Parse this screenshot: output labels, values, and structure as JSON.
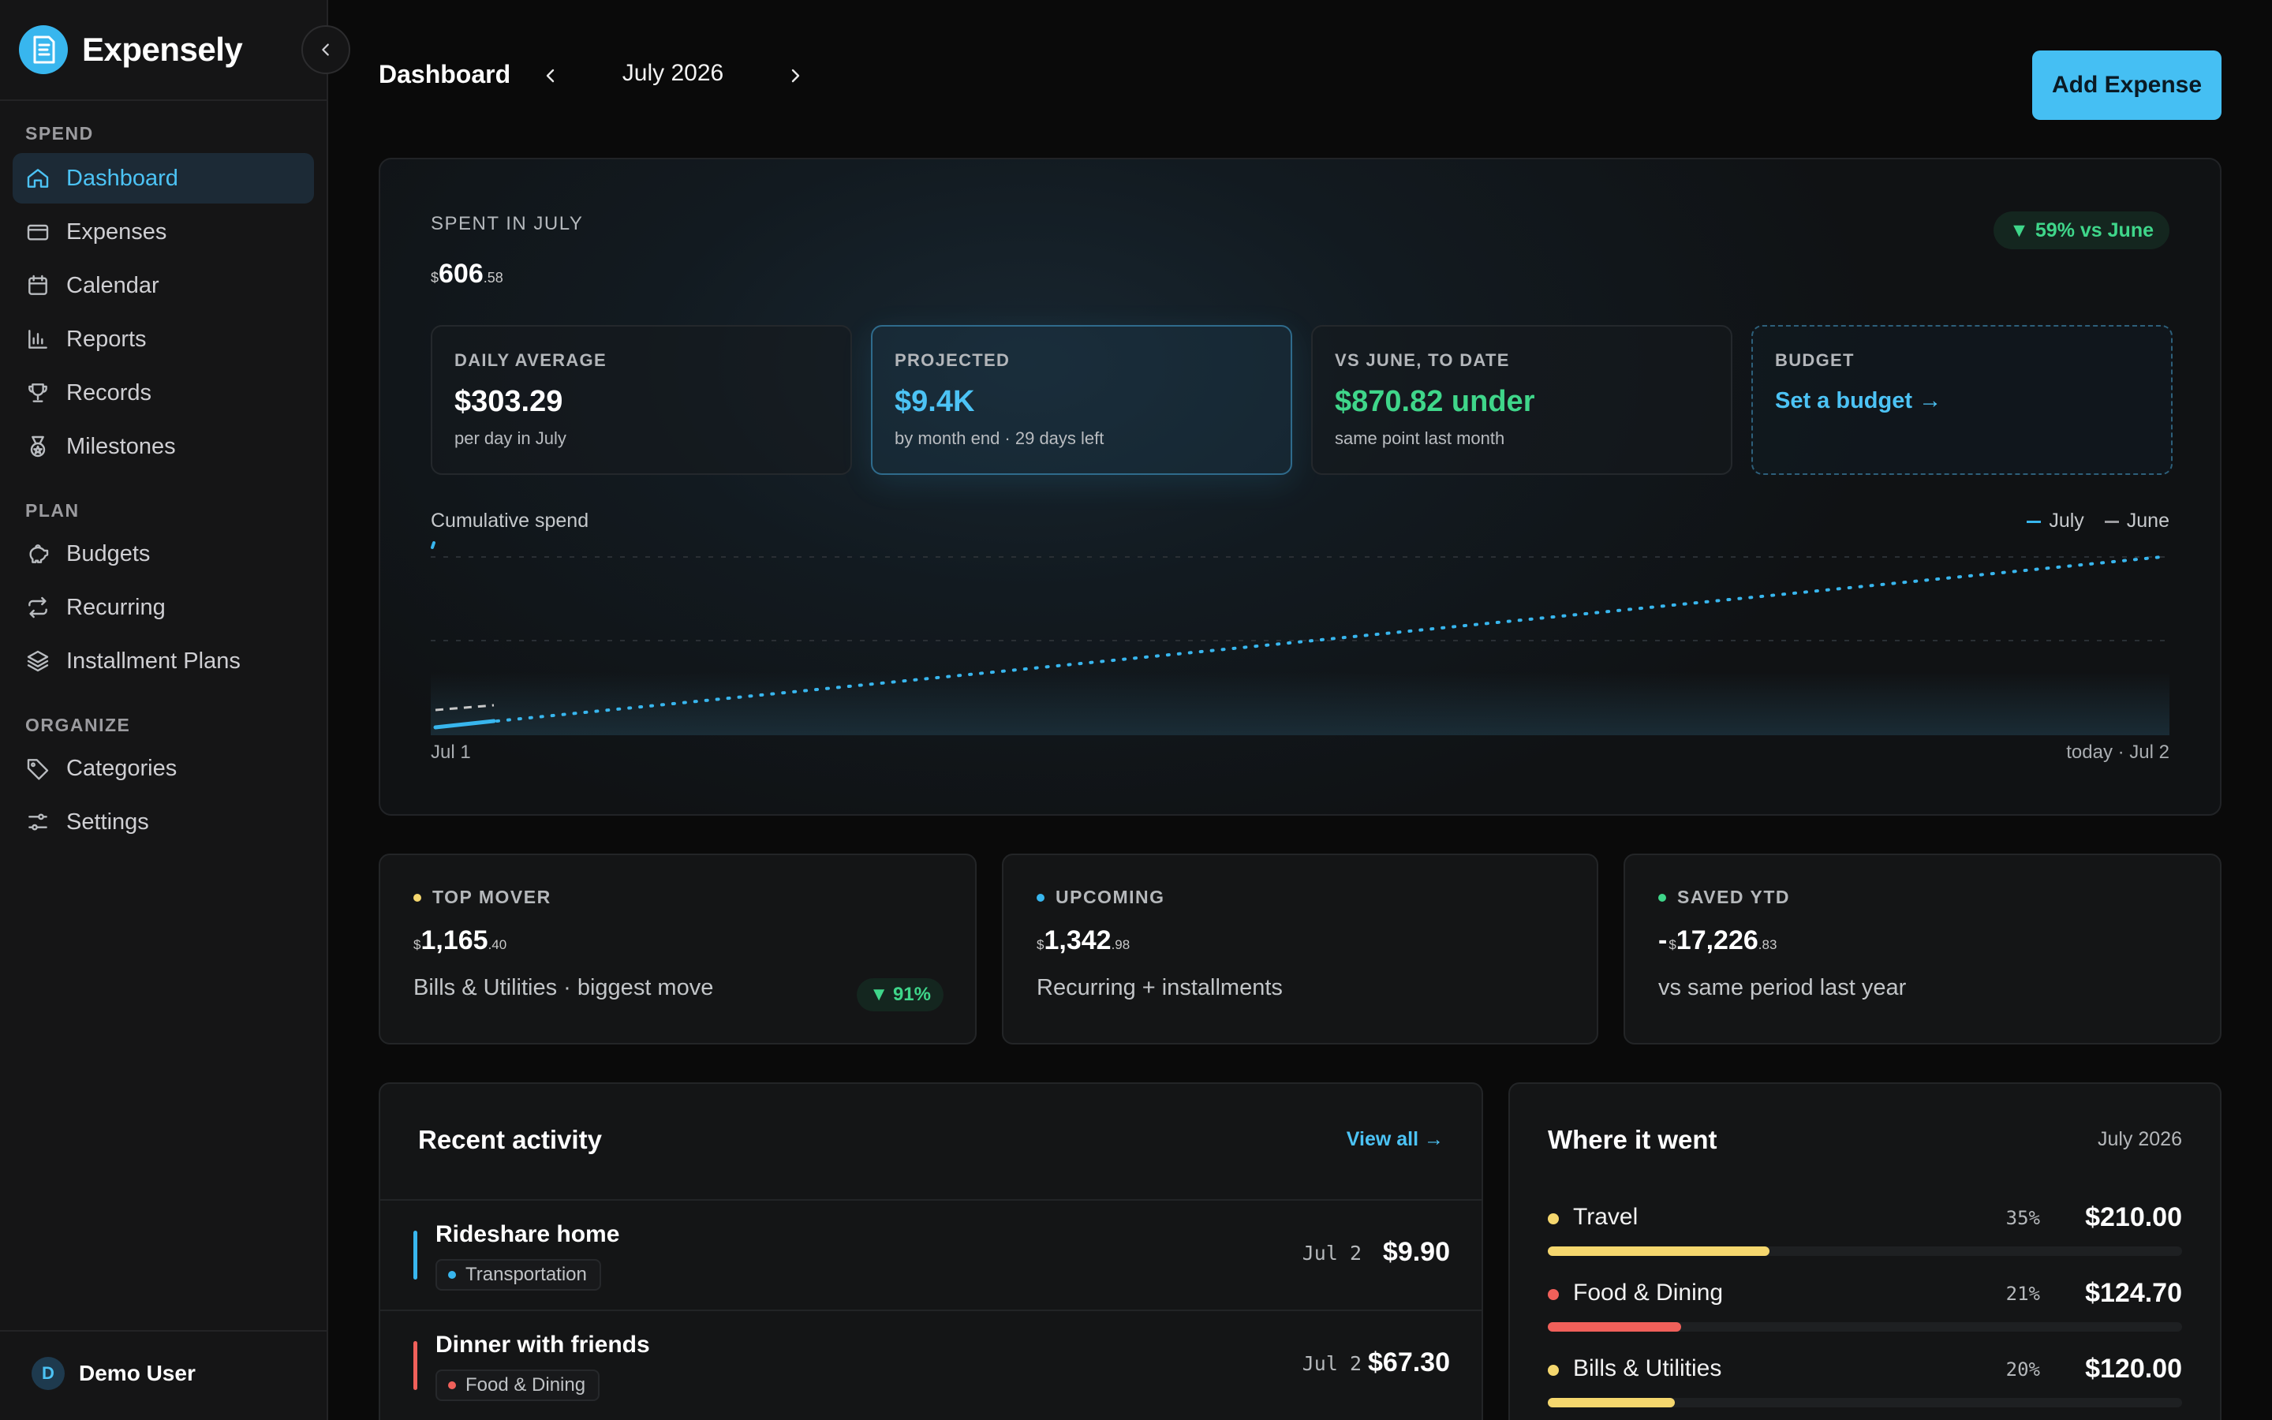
{
  "app": {
    "name": "Expensely"
  },
  "sidebar": {
    "sections": [
      {
        "label": "SPEND"
      },
      {
        "label": "PLAN"
      },
      {
        "label": "ORGANIZE"
      }
    ],
    "items": [
      {
        "label": "Dashboard",
        "icon": "home-icon",
        "active": true
      },
      {
        "label": "Expenses",
        "icon": "credit-card-icon"
      },
      {
        "label": "Calendar",
        "icon": "calendar-icon"
      },
      {
        "label": "Reports",
        "icon": "bar-chart-icon"
      },
      {
        "label": "Records",
        "icon": "trophy-icon"
      },
      {
        "label": "Milestones",
        "icon": "medal-icon"
      },
      {
        "label": "Budgets",
        "icon": "piggy-bank-icon"
      },
      {
        "label": "Recurring",
        "icon": "repeat-icon"
      },
      {
        "label": "Installment Plans",
        "icon": "layers-icon"
      },
      {
        "label": "Categories",
        "icon": "tag-icon"
      },
      {
        "label": "Settings",
        "icon": "sliders-icon"
      }
    ],
    "user": {
      "initial": "D",
      "name": "Demo User"
    }
  },
  "header": {
    "title": "Dashboard",
    "month": "July 2026",
    "add_button": "Add Expense"
  },
  "hero": {
    "label": "SPENT IN JULY",
    "amount": {
      "currency": "$",
      "int": "606",
      "dec": ".58"
    },
    "trend": {
      "arrow": "▼",
      "text": "59% vs June"
    },
    "stats": [
      {
        "label": "DAILY AVERAGE",
        "value": "$303.29",
        "sub": "per day in July"
      },
      {
        "label": "PROJECTED",
        "value": "$9.4K",
        "sub": "by month end · 29 days left"
      },
      {
        "label": "VS JUNE, TO DATE",
        "value": "$870.82 under",
        "sub": "same point last month"
      },
      {
        "label": "BUDGET",
        "link": "Set a budget →"
      }
    ],
    "chart": {
      "title": "Cumulative spend",
      "legend": [
        "July",
        "June"
      ],
      "axis_start": "Jul 1",
      "axis_end": "today · Jul 2"
    }
  },
  "kpis": [
    {
      "label": "TOP MOVER",
      "neg": "",
      "currency": "$",
      "int": "1,165",
      "dec": ".40",
      "sub": "Bills & Utilities · biggest move",
      "pill": {
        "arrow": "▼",
        "text": "91%"
      }
    },
    {
      "label": "UPCOMING",
      "neg": "",
      "currency": "$",
      "int": "1,342",
      "dec": ".98",
      "sub": "Recurring + installments"
    },
    {
      "label": "SAVED YTD",
      "neg": "-",
      "currency": "$",
      "int": "17,226",
      "dec": ".83",
      "sub": "vs same period last year"
    }
  ],
  "activity": {
    "title": "Recent activity",
    "view_all": "View all →",
    "items": [
      {
        "title": "Rideshare home",
        "category": "Transportation",
        "date": "Jul 2",
        "amount": "$9.90"
      },
      {
        "title": "Dinner with friends",
        "category": "Food & Dining",
        "date": "Jul 2",
        "amount": "$67.30"
      }
    ]
  },
  "where": {
    "title": "Where it went",
    "month": "July 2026",
    "items": [
      {
        "name": "Travel",
        "pct": "35%",
        "amount": "$210.00",
        "share": 0.35
      },
      {
        "name": "Food & Dining",
        "pct": "21%",
        "amount": "$124.70",
        "share": 0.21
      },
      {
        "name": "Bills & Utilities",
        "pct": "20%",
        "amount": "$120.00",
        "share": 0.2
      }
    ]
  },
  "colors": {
    "accent": "#45bff3",
    "positive": "#3fd68a",
    "transportation": "#38b6ee",
    "food": "#f0605a",
    "travel": "#f5d76e",
    "bills": "#f5d76e",
    "top_mover": "#f5d76e",
    "upcoming": "#38b6ee",
    "saved": "#3fd68a"
  }
}
